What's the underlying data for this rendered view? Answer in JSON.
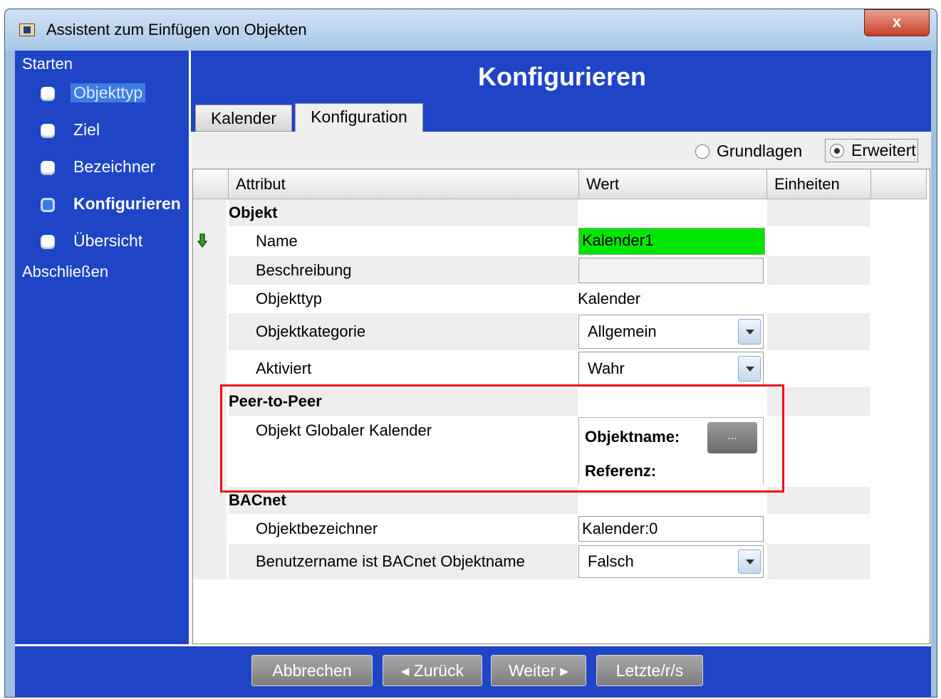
{
  "window": {
    "title": "Assistent zum Einfügen von Objekten",
    "close_label": "x"
  },
  "sidebar": {
    "start_label": "Starten",
    "items": [
      {
        "label": "Objekttyp"
      },
      {
        "label": "Ziel"
      },
      {
        "label": "Bezeichner"
      },
      {
        "label": "Konfigurieren"
      },
      {
        "label": "Übersicht"
      }
    ],
    "end_label": "Abschließen"
  },
  "main": {
    "title": "Konfigurieren",
    "tabs": [
      {
        "label": "Kalender"
      },
      {
        "label": "Konfiguration"
      }
    ],
    "active_tab": "Konfiguration",
    "radios": [
      {
        "label": "Grundlagen",
        "checked": false
      },
      {
        "label": "Erweitert",
        "checked": true
      }
    ]
  },
  "grid": {
    "headers": {
      "attribute": "Attribut",
      "value": "Wert",
      "units": "Einheiten"
    },
    "sections": {
      "objekt": "Objekt",
      "peer": "Peer-to-Peer",
      "bacnet": "BACnet"
    },
    "rows": {
      "name": {
        "label": "Name",
        "value": "Kalender1"
      },
      "beschreibung": {
        "label": "Beschreibung",
        "value": ""
      },
      "objekttyp": {
        "label": "Objekttyp",
        "value": "Kalender"
      },
      "objektkategorie": {
        "label": "Objektkategorie",
        "value": "Allgemein"
      },
      "aktiviert": {
        "label": "Aktiviert",
        "value": "Wahr"
      },
      "globaler_kalender": {
        "label": "Objekt Globaler Kalender",
        "objektname_label": "Objektname:",
        "referenz_label": "Referenz:",
        "browse_label": "..."
      },
      "objektbezeichner": {
        "label": "Objektbezeichner",
        "value": "Kalender:0"
      },
      "benutzername": {
        "label": "Benutzername ist BACnet Objektname",
        "value": "Falsch"
      }
    }
  },
  "footer": {
    "cancel": "Abbrechen",
    "back": "◂  Zurück",
    "next": "Weiter  ▸",
    "last": "Letzte/r/s"
  },
  "colors": {
    "accent": "#1f44c6",
    "highlight_green": "#00e600",
    "annotation_red": "#e8101a"
  }
}
